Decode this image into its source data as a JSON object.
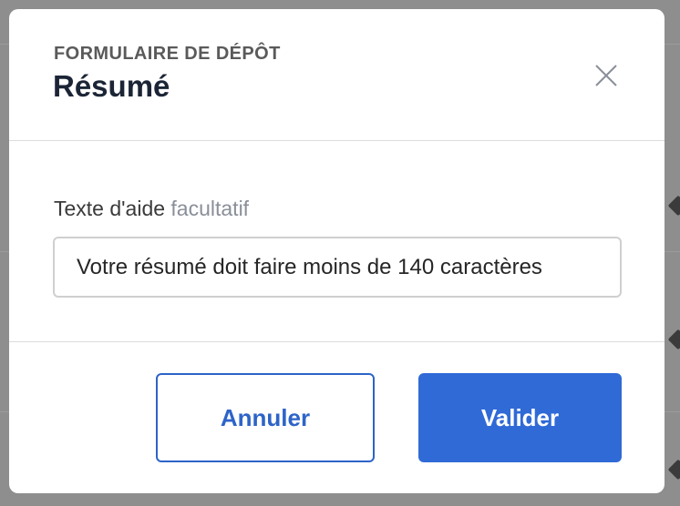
{
  "dialog": {
    "eyebrow": "FORMULAIRE DE DÉPÔT",
    "title": "Résumé",
    "close_icon": "close-icon"
  },
  "field": {
    "label": "Texte d'aide",
    "optional_tag": "facultatif",
    "value": "Votre résumé doit faire moins de 140 caractères"
  },
  "actions": {
    "cancel_label": "Annuler",
    "submit_label": "Valider"
  },
  "colors": {
    "accent": "#2f6ad6",
    "title": "#1b2536",
    "overlay": "#8e8e8e"
  }
}
